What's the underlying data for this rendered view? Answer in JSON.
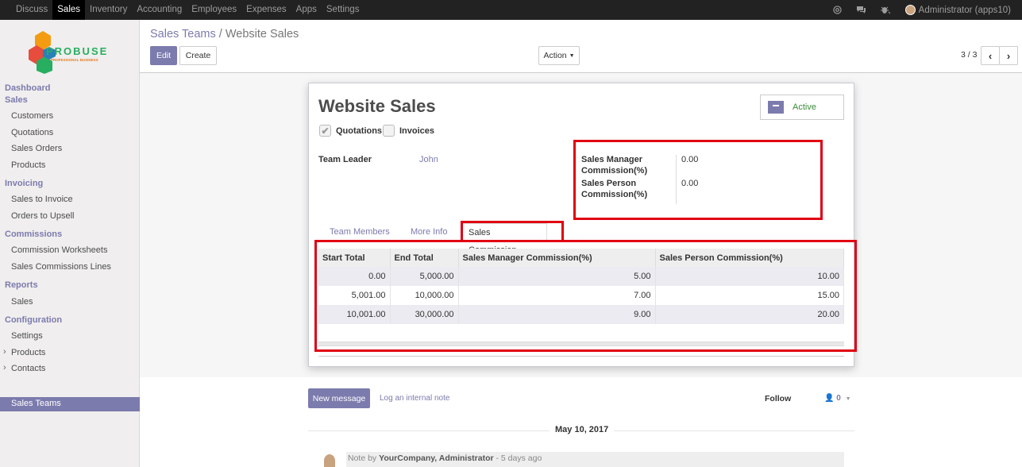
{
  "topbar": {
    "menu": [
      "Discuss",
      "Sales",
      "Inventory",
      "Accounting",
      "Employees",
      "Expenses",
      "Apps",
      "Settings"
    ],
    "active": "Sales",
    "user": "Administrator (apps10)",
    "icons": [
      "at-icon",
      "chat-icon",
      "bug-icon"
    ]
  },
  "sidebar": {
    "logo": {
      "name": "PROBUSE",
      "tagline": "PROFESSIONAL BUSINESS"
    },
    "dashboard": "Dashboard",
    "sections": [
      {
        "title": "Sales",
        "items": [
          "Customers",
          "Quotations",
          "Sales Orders",
          "Products"
        ]
      },
      {
        "title": "Invoicing",
        "items": [
          "Sales to Invoice",
          "Orders to Upsell"
        ]
      },
      {
        "title": "Commissions",
        "items": [
          "Commission Worksheets",
          "Sales Commissions Lines"
        ]
      },
      {
        "title": "Reports",
        "items": [
          "Sales"
        ]
      },
      {
        "title": "Configuration",
        "items": [
          "Settings",
          "Products",
          "Contacts",
          "Sales Teams"
        ]
      }
    ],
    "active_item": "Sales Teams"
  },
  "control": {
    "breadcrumb_parent": "Sales Teams",
    "breadcrumb_sep": "/",
    "breadcrumb_current": "Website Sales",
    "edit_label": "Edit",
    "create_label": "Create",
    "action_label": "Action",
    "pager": "3 / 3"
  },
  "form": {
    "title": "Website Sales",
    "status": "Active",
    "quotations_label": "Quotations",
    "invoices_label": "Invoices",
    "quotations_checked": true,
    "invoices_checked": false,
    "team_leader_label": "Team Leader",
    "team_leader_value": "John",
    "sm_commission_label_1": "Sales Manager",
    "sm_commission_label_2": "Commission(%)",
    "sm_commission_value": "0.00",
    "sp_commission_label_1": "Sales Person",
    "sp_commission_label_2": "Commission(%)",
    "sp_commission_value": "0.00"
  },
  "tabs": [
    "Team Members",
    "More Info",
    "Sales Commission"
  ],
  "active_tab": "Sales Commission",
  "commission_table": {
    "headers": [
      "Start Total",
      "End Total",
      "Sales Manager Commission(%)",
      "Sales Person Commission(%)"
    ],
    "rows": [
      [
        "0.00",
        "5,000.00",
        "5.00",
        "10.00"
      ],
      [
        "5,001.00",
        "10,000.00",
        "7.00",
        "15.00"
      ],
      [
        "10,001.00",
        "30,000.00",
        "9.00",
        "20.00"
      ]
    ]
  },
  "chatter": {
    "new_message": "New message",
    "log_note": "Log an internal note",
    "follow": "Follow",
    "followers": "0",
    "date": "May 10, 2017",
    "note_prefix": "Note by",
    "note_author": "YourCompany, Administrator",
    "note_time": "- 5 days ago"
  },
  "colors": {
    "accent": "#7c7bad",
    "highlight": "#e00012",
    "topbar": "#222222"
  }
}
